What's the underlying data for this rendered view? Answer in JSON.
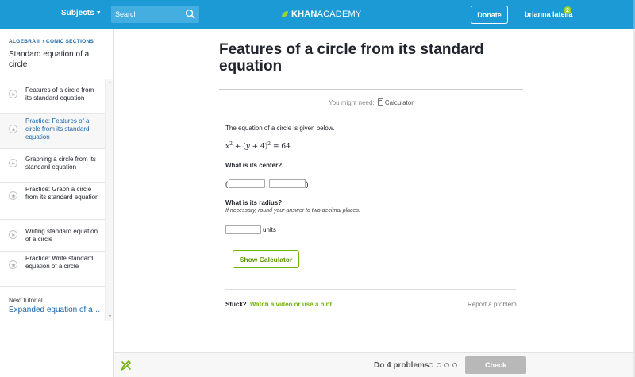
{
  "header": {
    "subjects_label": "Subjects",
    "search_placeholder": "Search",
    "logo_text_khan": "KHAN",
    "logo_text_academy": "ACADEMY",
    "donate_label": "Donate",
    "user_name": "brianna latella",
    "notification_count": "2"
  },
  "sidebar": {
    "breadcrumb": "ALGEBRA II  ›  CONIC SECTIONS",
    "tutorial_title": "Standard equation of a circle",
    "items": [
      {
        "label": "Features of a circle from its standard equation",
        "icon": "play-icon"
      },
      {
        "label": "Practice: Features of a circle from its standard equation",
        "icon": "star-icon"
      },
      {
        "label": "Graphing a circle from its standard equation",
        "icon": "play-icon"
      },
      {
        "label": "Practice: Graph a circle from its standard equation",
        "icon": "star-icon"
      },
      {
        "label": "Writing standard equation of a circle",
        "icon": "play-icon"
      },
      {
        "label": "Practice: Write standard equation of a circle",
        "icon": "star-icon"
      }
    ],
    "active_index": 1,
    "next_label": "Next tutorial",
    "next_link": "Expanded equation of a circle"
  },
  "main": {
    "title": "Features of a circle from its standard equation",
    "might_need": "You might need:",
    "calculator_link": "Calculator",
    "prompt": "The equation of a circle is given below.",
    "question_center": "What is its center?",
    "coord_open": "(",
    "coord_comma": ",",
    "coord_close": ")",
    "question_radius": "What is its radius?",
    "radius_hint": "If necessary, round your answer to two decimal places.",
    "units_label": "units",
    "show_calculator": "Show Calculator",
    "stuck_label": "Stuck?",
    "hint_link": "Watch a video or use a hint.",
    "report_label": "Report a problem"
  },
  "footer": {
    "do_problems": "Do 4 problems",
    "progress_dots": 4,
    "check_label": "Check"
  },
  "colors": {
    "topbar": "#1c9ad6",
    "link_blue": "#1865a8",
    "green": "#71b307",
    "check_disabled": "#b8b8b8"
  }
}
